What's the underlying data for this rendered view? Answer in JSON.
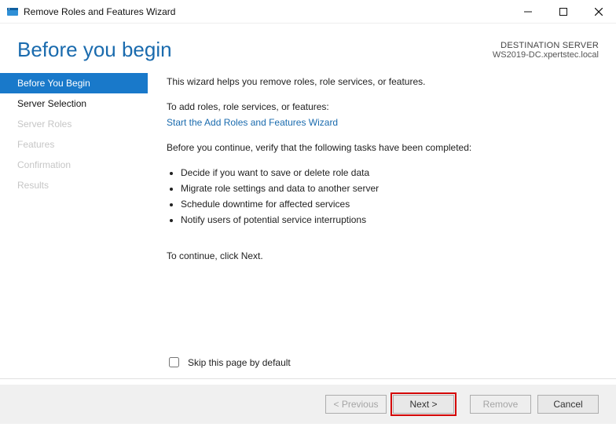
{
  "window": {
    "title": "Remove Roles and Features Wizard"
  },
  "header": {
    "title": "Before you begin",
    "dest_label": "DESTINATION SERVER",
    "dest_value": "WS2019-DC.xpertstec.local"
  },
  "sidebar": {
    "steps": [
      {
        "label": "Before You Begin",
        "state": "active"
      },
      {
        "label": "Server Selection",
        "state": "enabled"
      },
      {
        "label": "Server Roles",
        "state": "disabled"
      },
      {
        "label": "Features",
        "state": "disabled"
      },
      {
        "label": "Confirmation",
        "state": "disabled"
      },
      {
        "label": "Results",
        "state": "disabled"
      }
    ]
  },
  "content": {
    "intro": "This wizard helps you remove roles, role services, or features.",
    "add_prompt": "To add roles, role services, or features:",
    "add_link": "Start the Add Roles and Features Wizard",
    "verify": "Before you continue, verify that the following tasks have been completed:",
    "tasks": [
      "Decide if you want to save or delete role data",
      "Migrate role settings and data to another server",
      "Schedule downtime for affected services",
      "Notify users of potential service interruptions"
    ],
    "continue": "To continue, click Next.",
    "skip_label": "Skip this page by default"
  },
  "footer": {
    "previous": "< Previous",
    "next": "Next >",
    "remove": "Remove",
    "cancel": "Cancel"
  }
}
